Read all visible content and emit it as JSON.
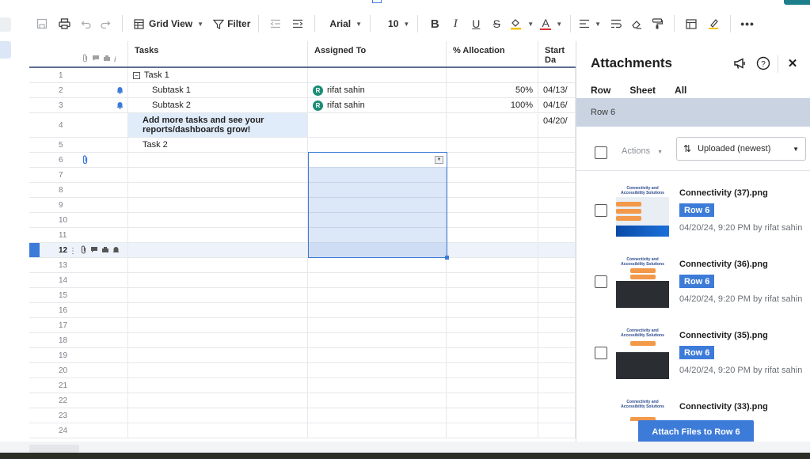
{
  "toolbar": {
    "view_label": "Grid View",
    "filter_label": "Filter",
    "font_name": "Arial",
    "font_size": "10"
  },
  "grid": {
    "columns": [
      "Tasks",
      "Assigned To",
      "% Allocation",
      "Start Da"
    ],
    "rows": [
      {
        "num": "1",
        "task": "Task 1",
        "assigned": "",
        "alloc": "",
        "start": ""
      },
      {
        "num": "2",
        "task": "Subtask 1",
        "assigned": "rifat sahin",
        "alloc": "50%",
        "start": "04/13/"
      },
      {
        "num": "3",
        "task": "Subtask 2",
        "assigned": "rifat sahin",
        "alloc": "100%",
        "start": "04/16/"
      },
      {
        "num": "4",
        "task": "Add more tasks and see your reports/dashboards grow!",
        "assigned": "",
        "alloc": "",
        "start": "04/20/"
      },
      {
        "num": "5",
        "task": "Task 2",
        "assigned": "",
        "alloc": "",
        "start": ""
      },
      {
        "num": "6"
      },
      {
        "num": "7"
      },
      {
        "num": "8"
      },
      {
        "num": "9"
      },
      {
        "num": "10"
      },
      {
        "num": "11"
      },
      {
        "num": "12"
      },
      {
        "num": "13"
      },
      {
        "num": "14"
      },
      {
        "num": "15"
      },
      {
        "num": "16"
      },
      {
        "num": "17"
      },
      {
        "num": "18"
      },
      {
        "num": "19"
      },
      {
        "num": "20"
      },
      {
        "num": "21"
      },
      {
        "num": "22"
      },
      {
        "num": "23"
      },
      {
        "num": "24"
      }
    ],
    "avatar_initial": "R"
  },
  "panel": {
    "title": "Attachments",
    "tabs": [
      "Row",
      "Sheet",
      "All"
    ],
    "row_banner": "Row 6",
    "actions_label": "Actions",
    "sort_label": "Uploaded (newest)",
    "attachments": [
      {
        "name": "Connectivity (37).png",
        "badge": "Row 6",
        "meta": "04/20/24, 9:20 PM by rifat sahin",
        "thumb_title": "Connectivity and Accessibility Solutions"
      },
      {
        "name": "Connectivity (36).png",
        "badge": "Row 6",
        "meta": "04/20/24, 9:20 PM by rifat sahin",
        "thumb_title": "Connectivity and Accessibility Solutions"
      },
      {
        "name": "Connectivity (35).png",
        "badge": "Row 6",
        "meta": "04/20/24, 9:20 PM by rifat sahin",
        "thumb_title": "Connectivity and Accessibility Solutions"
      },
      {
        "name": "Connectivity (33).png",
        "thumb_title": "Connectivity and Accessibility Solutions"
      }
    ],
    "attach_button": "Attach Files to Row 6"
  },
  "colors": {
    "accent": "#3d7bd9",
    "avatar": "#1c8c76",
    "banner": "#c9d3e1"
  }
}
